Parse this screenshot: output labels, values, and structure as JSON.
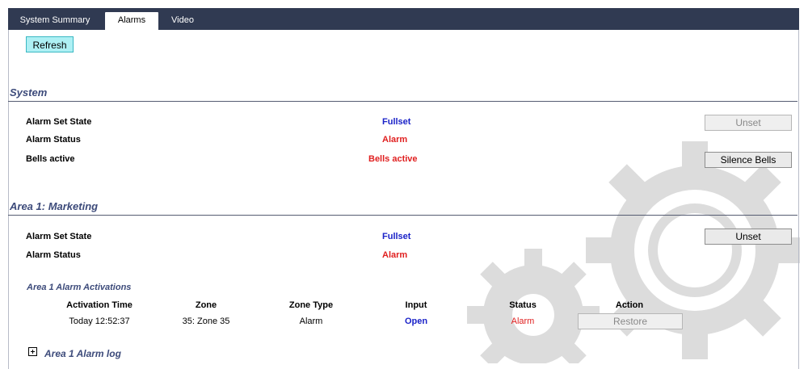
{
  "tabs": [
    {
      "label": "System Summary",
      "active": false
    },
    {
      "label": "Alarms",
      "active": true
    },
    {
      "label": "Video",
      "active": false
    }
  ],
  "toolbar": {
    "refresh_label": "Refresh"
  },
  "system": {
    "title": "System",
    "alarm_set_state_label": "Alarm Set State",
    "alarm_set_state_value": "Fullset",
    "alarm_status_label": "Alarm Status",
    "alarm_status_value": "Alarm",
    "bells_active_label": "Bells active",
    "bells_active_value": "Bells active",
    "unset_label": "Unset",
    "unset_disabled": true,
    "silence_bells_label": "Silence Bells"
  },
  "area1": {
    "title": "Area 1: Marketing",
    "alarm_set_state_label": "Alarm Set State",
    "alarm_set_state_value": "Fullset",
    "alarm_status_label": "Alarm Status",
    "alarm_status_value": "Alarm",
    "unset_label": "Unset",
    "activations_title": "Area 1 Alarm Activations",
    "columns": [
      "Activation Time",
      "Zone",
      "Zone Type",
      "Input",
      "Status",
      "Action"
    ],
    "rows": [
      {
        "activation_time": "Today 12:52:37",
        "zone": "35: Zone 35",
        "zone_type": "Alarm",
        "input": "Open",
        "status": "Alarm",
        "action": "Restore"
      }
    ],
    "log_title": "Area 1 Alarm log"
  },
  "colors": {
    "tabbar": "#303a52",
    "section_title": "#3c4a7a",
    "value_blue": "#1a22c8",
    "value_red": "#e02020",
    "refresh_bg": "#aef0f4"
  },
  "icons": {
    "background": "gears-watermark",
    "expand": "plus-box-icon"
  }
}
